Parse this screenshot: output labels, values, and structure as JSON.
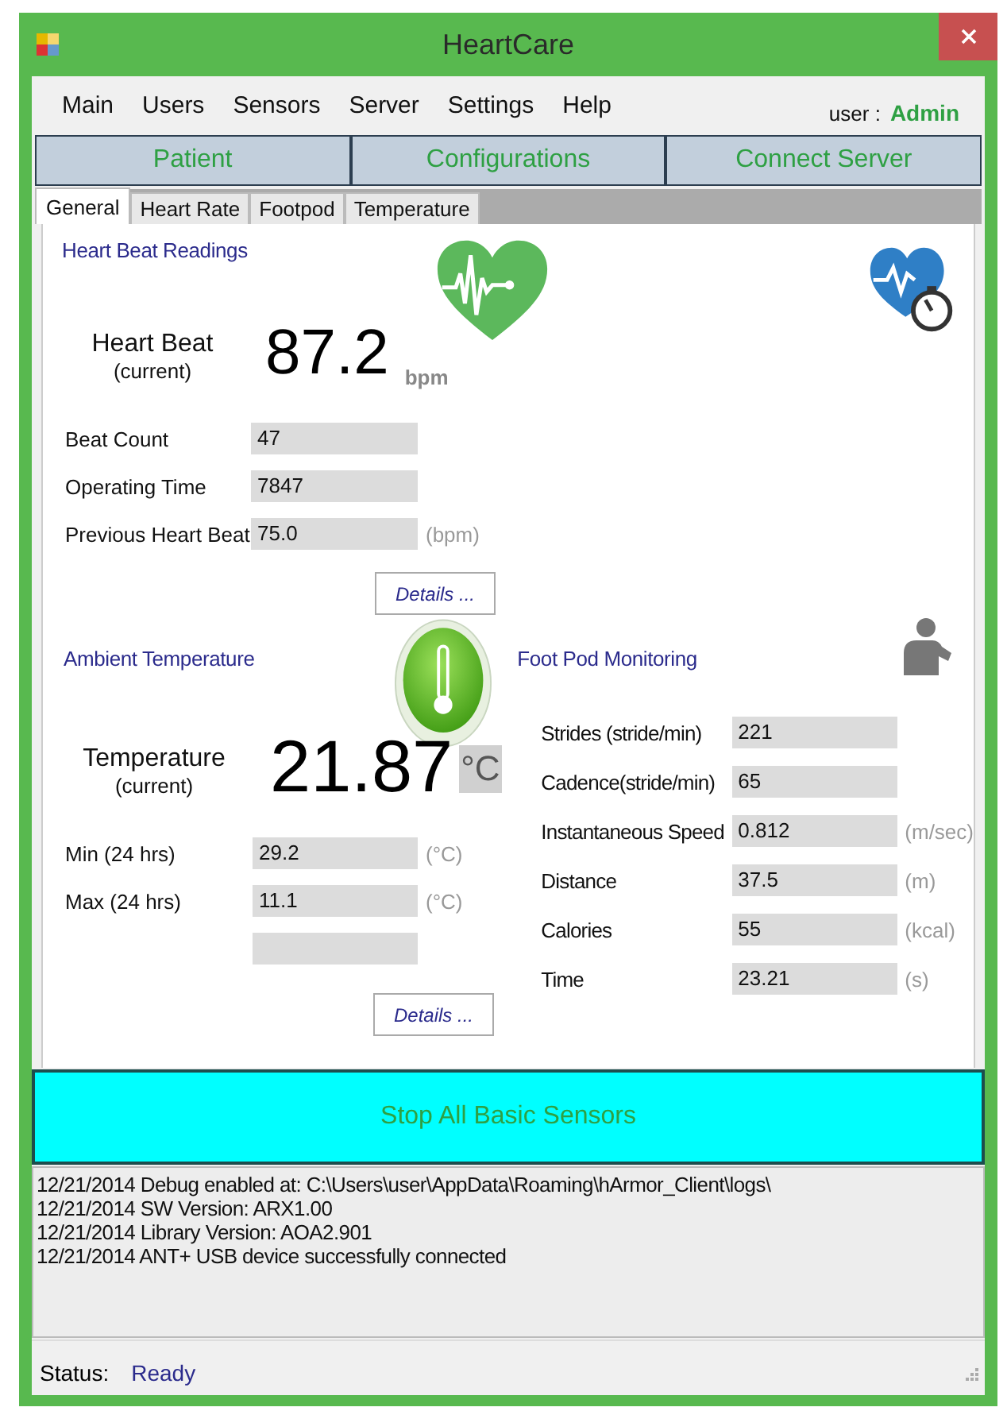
{
  "window": {
    "title": "HeartCare"
  },
  "menu": [
    "Main",
    "Users",
    "Sensors",
    "Server",
    "Settings",
    "Help"
  ],
  "user": {
    "label": "user :",
    "name": "Admin"
  },
  "nav_buttons": [
    "Patient",
    "Configurations",
    "Connect Server"
  ],
  "tabs": [
    {
      "label": "General",
      "selected": true
    },
    {
      "label": "Heart Rate",
      "selected": false
    },
    {
      "label": "Footpod",
      "selected": false
    },
    {
      "label": "Temperature",
      "selected": false
    }
  ],
  "heart": {
    "title": "Heart Beat Readings",
    "reading_label": "Heart Beat",
    "reading_sublabel": "(current)",
    "value": "87.2",
    "unit": "bpm",
    "fields": [
      {
        "kind": "row",
        "label": "Beat Count",
        "value": "47"
      },
      {
        "kind": "row",
        "label": "Operating Time",
        "value": "7847"
      },
      {
        "kind": "row",
        "label": "Previous Heart Beat",
        "value": "75.0",
        "unit": "(bpm)"
      }
    ],
    "details_button": "Details ..."
  },
  "temperature": {
    "title": "Ambient Temperature",
    "reading_label": "Temperature",
    "reading_sublabel": "(current)",
    "value": "21.87",
    "unit": "°C",
    "fields": [
      {
        "kind": "row",
        "label": "Min (24 hrs)",
        "value": "29.2",
        "unit": "(°C)"
      },
      {
        "kind": "row",
        "label": "Max (24 hrs)",
        "value": "11.1",
        "unit": "(°C)"
      },
      {
        "kind": "blank"
      }
    ],
    "details_button": "Details ..."
  },
  "footpod": {
    "title": "Foot Pod Monitoring",
    "fields": [
      {
        "kind": "row",
        "label": "Strides  (stride/min)",
        "value": "221"
      },
      {
        "kind": "row",
        "label": "Cadence(stride/min)",
        "value": "65"
      },
      {
        "kind": "row",
        "label": "Instantaneous Speed",
        "value": "0.812",
        "unit": "(m/sec)"
      },
      {
        "kind": "row",
        "label": "Distance",
        "value": "37.5",
        "unit": "(m)"
      },
      {
        "kind": "row",
        "label": "Calories",
        "value": "55",
        "unit": "(kcal)"
      },
      {
        "kind": "row",
        "label": "Time",
        "value": "23.21",
        "unit": "(s)"
      }
    ]
  },
  "stop_button": "Stop All Basic Sensors",
  "log": [
    "12/21/2014 Debug enabled at: C:\\Users\\user\\AppData\\Roaming\\hArmor_Client\\logs\\",
    "12/21/2014 SW Version: ARX1.00",
    "12/21/2014 Library Version: AOA2.901",
    "12/21/2014 ANT+ USB device successfully connected"
  ],
  "status": {
    "label": "Status:",
    "value": "Ready"
  }
}
